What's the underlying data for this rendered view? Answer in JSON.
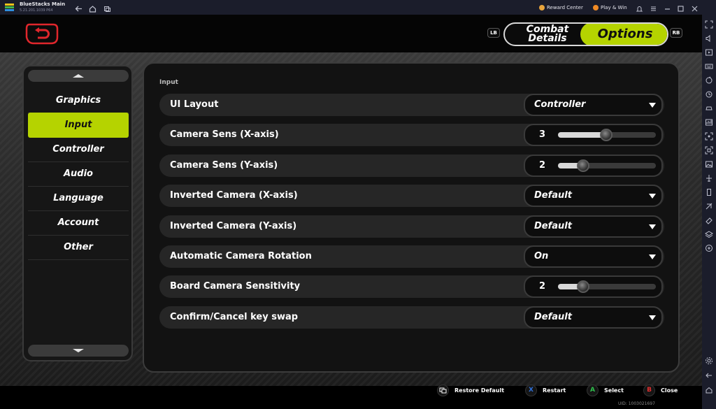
{
  "window": {
    "app_title": "BlueStacks Main",
    "version": "5.21.201.1039 P64",
    "reward_center": "Reward Center",
    "play_win": "Play & Win"
  },
  "header": {
    "lb": "LB",
    "rb": "RB",
    "tab_combat_line1": "Combat",
    "tab_combat_line2": "Details",
    "tab_options": "Options"
  },
  "categories": {
    "items": [
      "Graphics",
      "Input",
      "Controller",
      "Audio",
      "Language",
      "Account",
      "Other"
    ],
    "selected": "Input"
  },
  "section": {
    "title": "Input"
  },
  "settings": [
    {
      "label": "UI Layout",
      "type": "dropdown",
      "value": "Controller"
    },
    {
      "label": "Camera Sens (X-axis)",
      "type": "slider",
      "value": "3"
    },
    {
      "label": "Camera Sens (Y-axis)",
      "type": "slider",
      "value": "2"
    },
    {
      "label": "Inverted Camera (X-axis)",
      "type": "dropdown",
      "value": "Default"
    },
    {
      "label": "Inverted Camera (Y-axis)",
      "type": "dropdown",
      "value": "Default"
    },
    {
      "label": "Automatic Camera Rotation",
      "type": "dropdown",
      "value": "On"
    },
    {
      "label": "Board Camera Sensitivity",
      "type": "slider",
      "value": "2"
    },
    {
      "label": "Confirm/Cancel key swap",
      "type": "dropdown",
      "value": "Default"
    }
  ],
  "footer": {
    "restore": "Restore Default",
    "restart_key": "X",
    "restart": "Restart",
    "select_key": "A",
    "select": "Select",
    "close_key": "B",
    "close": "Close",
    "uid": "UID: 1003021697"
  },
  "colors": {
    "accent": "#b5d300",
    "back_button": "#e0262c",
    "x_button": "#2f6fd8",
    "a_button": "#2fbf4c",
    "b_button": "#e03030"
  }
}
